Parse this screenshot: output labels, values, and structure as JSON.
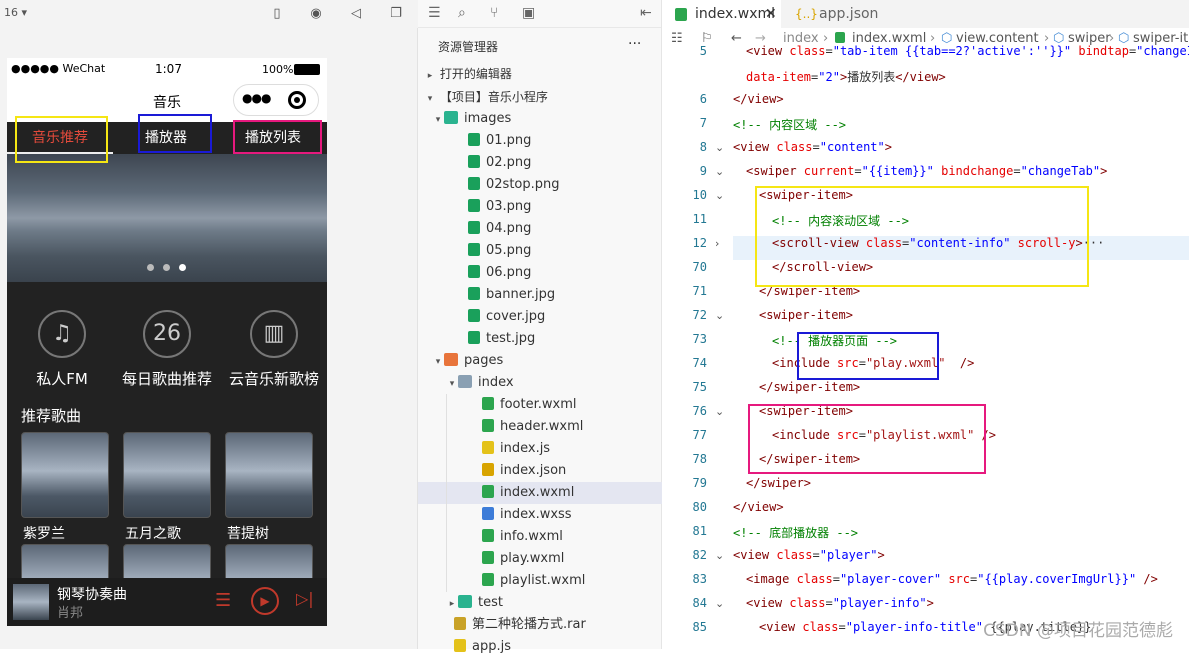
{
  "simulator": {
    "zoom": "16",
    "status": {
      "carrier": "●●●●● WeChat",
      "time": "1:07",
      "battery": "100%"
    },
    "nav_title": "音乐",
    "capsule_dots": "●●●",
    "tabs": [
      "音乐推荐",
      "播放器",
      "播放列表"
    ],
    "icons": [
      {
        "glyph": "♫",
        "label": "私人FM",
        "icon": "runner-icon"
      },
      {
        "glyph": "26",
        "label": "每日歌曲推荐",
        "icon": "calendar-icon"
      },
      {
        "glyph": "▥",
        "label": "云音乐新歌榜",
        "icon": "chart-icon"
      }
    ],
    "section_title": "推荐歌曲",
    "songs": [
      "紫罗兰",
      "五月之歌",
      "菩提树"
    ],
    "player": {
      "title": "钢琴协奏曲",
      "artist": "肖邦"
    },
    "highlight_colors": {
      "yellow": "#f5e614",
      "blue": "#1a1ad6",
      "pink": "#e6197e"
    }
  },
  "explorer": {
    "title": "资源管理器",
    "more": "···",
    "open_editors": "打开的编辑器",
    "project": "【项目】音乐小程序",
    "tree": [
      {
        "label": "images",
        "type": "folder",
        "depth": 1,
        "open": true
      },
      {
        "label": "01.png",
        "type": "img",
        "depth": 2
      },
      {
        "label": "02.png",
        "type": "img",
        "depth": 2
      },
      {
        "label": "02stop.png",
        "type": "img",
        "depth": 2
      },
      {
        "label": "03.png",
        "type": "img",
        "depth": 2
      },
      {
        "label": "04.png",
        "type": "img",
        "depth": 2
      },
      {
        "label": "05.png",
        "type": "img",
        "depth": 2
      },
      {
        "label": "06.png",
        "type": "img",
        "depth": 2
      },
      {
        "label": "banner.jpg",
        "type": "img",
        "depth": 2
      },
      {
        "label": "cover.jpg",
        "type": "img",
        "depth": 2
      },
      {
        "label": "test.jpg",
        "type": "img",
        "depth": 2
      },
      {
        "label": "pages",
        "type": "folder",
        "depth": 1,
        "open": true
      },
      {
        "label": "index",
        "type": "folder",
        "depth": 2,
        "open": true
      },
      {
        "label": "footer.wxml",
        "type": "wxml",
        "depth": 3
      },
      {
        "label": "header.wxml",
        "type": "wxml",
        "depth": 3
      },
      {
        "label": "index.js",
        "type": "js",
        "depth": 3
      },
      {
        "label": "index.json",
        "type": "json",
        "depth": 3
      },
      {
        "label": "index.wxml",
        "type": "wxml",
        "depth": 3,
        "selected": true
      },
      {
        "label": "index.wxss",
        "type": "wxss",
        "depth": 3
      },
      {
        "label": "info.wxml",
        "type": "wxml",
        "depth": 3
      },
      {
        "label": "play.wxml",
        "type": "wxml",
        "depth": 3
      },
      {
        "label": "playlist.wxml",
        "type": "wxml",
        "depth": 3
      },
      {
        "label": "test",
        "type": "folder",
        "depth": 2,
        "open": false
      },
      {
        "label": "第二种轮播方式.rar",
        "type": "rar",
        "depth": 1
      },
      {
        "label": "app.js",
        "type": "js",
        "depth": 1
      }
    ]
  },
  "editor": {
    "tabs": [
      "index.wxml",
      "app.json"
    ],
    "breadcrumb": [
      "index",
      "index.wxml",
      "view.content",
      "swiper",
      "swiper-it"
    ],
    "lines": [
      {
        "n": "5",
        "indent": 1,
        "parts": [
          [
            "t",
            "<view "
          ],
          [
            "a",
            "class"
          ],
          [
            "",
            "="
          ],
          [
            "s",
            "\"tab-item {{tab==2?'active':''}}\" "
          ],
          [
            "a",
            "bindtap"
          ],
          [
            "",
            "="
          ],
          [
            "s",
            "\"changeItem\""
          ]
        ]
      },
      {
        "n": "",
        "indent": 1,
        "parts": [
          [
            "a",
            "data-item"
          ],
          [
            "",
            "="
          ],
          [
            "s",
            "\"2\""
          ],
          [
            "t",
            ">"
          ],
          [
            "",
            "播放列表"
          ],
          [
            "t",
            "</view>"
          ]
        ]
      },
      {
        "n": "6",
        "indent": 0,
        "parts": [
          [
            "t",
            "</view>"
          ]
        ]
      },
      {
        "n": "7",
        "indent": 0,
        "parts": [
          [
            "c",
            "<!-- 内容区域 -->"
          ]
        ]
      },
      {
        "n": "8",
        "indent": 0,
        "fold": true,
        "parts": [
          [
            "t",
            "<view "
          ],
          [
            "a",
            "class"
          ],
          [
            "",
            "="
          ],
          [
            "s",
            "\"content\""
          ],
          [
            "t",
            ">"
          ]
        ]
      },
      {
        "n": "9",
        "indent": 1,
        "fold": true,
        "parts": [
          [
            "t",
            "<swiper "
          ],
          [
            "a",
            "current"
          ],
          [
            "",
            "="
          ],
          [
            "s",
            "\"{{item}}\" "
          ],
          [
            "a",
            "bindchange"
          ],
          [
            "",
            "="
          ],
          [
            "s",
            "\"changeTab\""
          ],
          [
            "t",
            ">"
          ]
        ]
      },
      {
        "n": "10",
        "indent": 2,
        "fold": true,
        "parts": [
          [
            "t",
            "<swiper-item>"
          ]
        ]
      },
      {
        "n": "11",
        "indent": 3,
        "parts": [
          [
            "c",
            "<!-- 内容滚动区域 -->"
          ]
        ]
      },
      {
        "n": "12",
        "indent": 3,
        "collapsed": true,
        "parts": [
          [
            "t",
            "<scroll-view "
          ],
          [
            "a",
            "class"
          ],
          [
            "",
            "="
          ],
          [
            "s",
            "\"content-info\" "
          ],
          [
            "a",
            "scroll-y"
          ],
          [
            "t",
            ">"
          ],
          [
            "",
            "···"
          ]
        ]
      },
      {
        "n": "70",
        "indent": 3,
        "parts": [
          [
            "t",
            "</scroll-view>"
          ]
        ]
      },
      {
        "n": "71",
        "indent": 2,
        "parts": [
          [
            "t",
            "</swiper-item>"
          ]
        ]
      },
      {
        "n": "72",
        "indent": 2,
        "fold": true,
        "parts": [
          [
            "t",
            "<swiper-item>"
          ]
        ]
      },
      {
        "n": "73",
        "indent": 3,
        "parts": [
          [
            "c",
            "<!-- 播放器页面 -->"
          ]
        ]
      },
      {
        "n": "74",
        "indent": 3,
        "parts": [
          [
            "t",
            "<include "
          ],
          [
            "a",
            "src"
          ],
          [
            "",
            "="
          ],
          [
            "m",
            "\"play.wxml\""
          ],
          [
            "",
            "  "
          ],
          [
            "t",
            "/>"
          ]
        ]
      },
      {
        "n": "75",
        "indent": 2,
        "parts": [
          [
            "t",
            "</swiper-item>"
          ]
        ]
      },
      {
        "n": "76",
        "indent": 2,
        "fold": true,
        "parts": [
          [
            "t",
            "<swiper-item>"
          ]
        ]
      },
      {
        "n": "77",
        "indent": 3,
        "parts": [
          [
            "t",
            "<include "
          ],
          [
            "a",
            "src"
          ],
          [
            "",
            "="
          ],
          [
            "m",
            "\"playlist.wxml\""
          ],
          [
            "",
            ""
          ],
          [
            "t",
            " />"
          ]
        ]
      },
      {
        "n": "78",
        "indent": 2,
        "parts": [
          [
            "t",
            "</swiper-item>"
          ]
        ]
      },
      {
        "n": "79",
        "indent": 1,
        "parts": [
          [
            "t",
            "</swiper>"
          ]
        ]
      },
      {
        "n": "80",
        "indent": 0,
        "parts": [
          [
            "t",
            "</view>"
          ]
        ]
      },
      {
        "n": "81",
        "indent": 0,
        "parts": [
          [
            "c",
            "<!-- 底部播放器 -->"
          ]
        ]
      },
      {
        "n": "82",
        "indent": 0,
        "fold": true,
        "parts": [
          [
            "t",
            "<view "
          ],
          [
            "a",
            "class"
          ],
          [
            "",
            "="
          ],
          [
            "s",
            "\"player\""
          ],
          [
            "t",
            ">"
          ]
        ]
      },
      {
        "n": "83",
        "indent": 1,
        "parts": [
          [
            "t",
            "<image "
          ],
          [
            "a",
            "class"
          ],
          [
            "",
            "="
          ],
          [
            "s",
            "\"player-cover\" "
          ],
          [
            "a",
            "src"
          ],
          [
            "",
            "="
          ],
          [
            "s",
            "\"{{play.coverImgUrl}}\""
          ],
          [
            "t",
            " />"
          ]
        ]
      },
      {
        "n": "84",
        "indent": 1,
        "fold": true,
        "parts": [
          [
            "t",
            "<view "
          ],
          [
            "a",
            "class"
          ],
          [
            "",
            "="
          ],
          [
            "s",
            "\"player-info\""
          ],
          [
            "t",
            ">"
          ]
        ]
      },
      {
        "n": "85",
        "indent": 2,
        "parts": [
          [
            "t",
            "<view "
          ],
          [
            "a",
            "class"
          ],
          [
            "",
            "="
          ],
          [
            "s",
            "\"player-info-title\" "
          ],
          [
            "",
            "{{play.title}}"
          ]
        ]
      }
    ]
  },
  "watermark": "CSDN @项目花园范德彪"
}
